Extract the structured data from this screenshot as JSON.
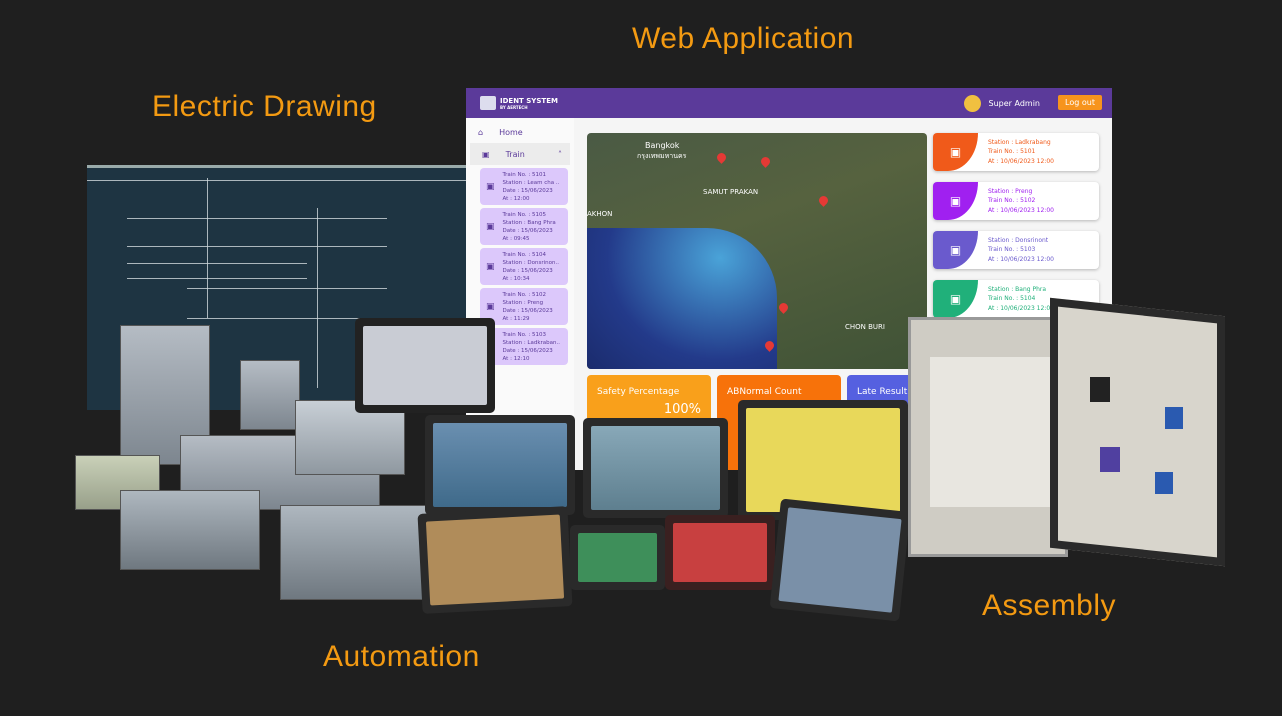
{
  "labels": {
    "web_app": "Web Application",
    "electric_drawing": "Electric Drawing",
    "automation": "Automation",
    "assembly": "Assembly"
  },
  "colors": {
    "background": "#1f1f1f",
    "label": "#f39a12",
    "app_header": "#5b3a9a",
    "logout": "#f7941d"
  },
  "app": {
    "logo_title": "IDENT SYSTEM",
    "logo_sub": "BY AERTECH",
    "user": "Super Admin",
    "logout": "Log out",
    "sidebar": {
      "home": "Home",
      "train": "Train",
      "items": [
        {
          "l1": "Train No. : 5101",
          "l2": "Station : Leam cha ..",
          "l3": "Date : 15/06/2023",
          "l4": "At : 12:00"
        },
        {
          "l1": "Train No. : 5105",
          "l2": "Station : Bang Phra",
          "l3": "Date : 15/06/2023",
          "l4": "At : 09:45"
        },
        {
          "l1": "Train No. : 5104",
          "l2": "Station : Donsrinon..",
          "l3": "Date : 15/06/2023",
          "l4": "At : 10:34"
        },
        {
          "l1": "Train No. : 5102",
          "l2": "Station : Preng",
          "l3": "Date : 15/06/2023",
          "l4": "At : 11:29"
        },
        {
          "l1": "Train No. : 5103",
          "l2": "Station : Ladkraban..",
          "l3": "Date : 15/06/2023",
          "l4": "At : 12:10"
        }
      ]
    },
    "map": {
      "bangkok": "Bangkok",
      "bangkok_th": "กรุงเทพมหานคร",
      "samut_prakan": "SAMUT PRAKAN",
      "chon_buri": "CHON BURI",
      "nakhon": "AKHON"
    },
    "cards": [
      {
        "station": "Station : Ladkrabang",
        "train": "Train No. : 5101",
        "at": "At : 10/06/2023 12:00",
        "color": "#f05a1a"
      },
      {
        "station": "Station : Preng",
        "train": "Train No. : 5102",
        "at": "At : 10/06/2023 12:00",
        "color": "#a020f0"
      },
      {
        "station": "Station : Donsrinont",
        "train": "Train No. : 5103",
        "at": "At : 10/06/2023 12:00",
        "color": "#6a5acd"
      },
      {
        "station": "Station : Bang Phra",
        "train": "Train No. : 5104",
        "at": "At : 10/06/2023 12:00",
        "color": "#20b07a"
      }
    ],
    "stats": [
      {
        "label": "Safety Percentage",
        "value": "100%",
        "color": "#f9a01b"
      },
      {
        "label": "ABNormal Count",
        "value": "",
        "color": "#f7720a"
      },
      {
        "label": "Late Result",
        "value": "",
        "color": "#5560e0"
      }
    ]
  }
}
